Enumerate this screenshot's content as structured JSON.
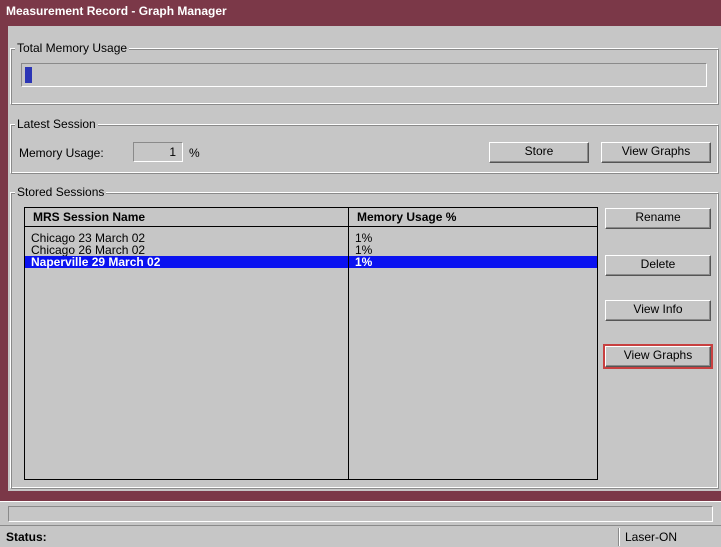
{
  "window": {
    "title": "Measurement Record - Graph Manager"
  },
  "memory_group": {
    "legend": "Total Memory Usage",
    "usage_fraction": 0.01
  },
  "latest_session": {
    "legend": "Latest Session",
    "memory_label": "Memory Usage:",
    "memory_value": "1",
    "memory_unit": "%",
    "store_button": "Store",
    "view_graphs_button": "View Graphs"
  },
  "stored_sessions": {
    "legend": "Stored Sessions",
    "columns": [
      "MRS Session Name",
      "Memory Usage %"
    ],
    "rows": [
      {
        "name": "Chicago 23 March 02",
        "usage": "1%"
      },
      {
        "name": "Chicago 26 March 02",
        "usage": "1%"
      },
      {
        "name": "Naperville 29 March 02",
        "usage": "1%"
      }
    ],
    "selected_row": 2,
    "buttons": {
      "rename": "Rename",
      "delete": "Delete",
      "view_info": "View Info",
      "view_graphs": "View Graphs"
    }
  },
  "statusbar": {
    "label": "Status:",
    "right_text": "Laser-ON"
  },
  "colors": {
    "title_bar": "#7b3848",
    "selection": "#0a12f0",
    "progress_fill": "#2b35b5",
    "focus_outline": "#c84040"
  }
}
